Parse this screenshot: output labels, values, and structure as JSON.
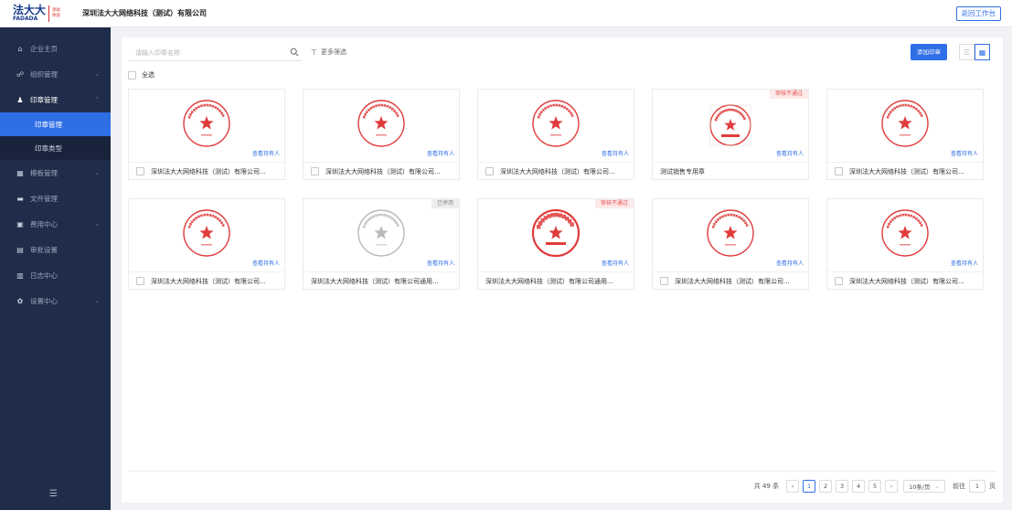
{
  "header": {
    "logo_cn": "法大大",
    "logo_en": "FADADA",
    "logo_badge_line1": "测试",
    "logo_badge_line2": "体验",
    "company": "深圳法大大网络科技（测试）有限公司",
    "back_button": "返回工作台"
  },
  "sidebar": {
    "items": [
      {
        "label": "企业主页",
        "icon": "home-icon",
        "glyph": "⌂",
        "has_chevron": false
      },
      {
        "label": "组织管理",
        "icon": "org-icon",
        "glyph": "☍",
        "has_chevron": true
      },
      {
        "label": "印章管理",
        "icon": "seal-user-icon",
        "glyph": "♟",
        "has_chevron": true,
        "open": true
      },
      {
        "label": "模板管理",
        "icon": "template-icon",
        "glyph": "▦",
        "has_chevron": true
      },
      {
        "label": "文件管理",
        "icon": "folder-icon",
        "glyph": "▬",
        "has_chevron": false
      },
      {
        "label": "费用中心",
        "icon": "fee-icon",
        "glyph": "▣",
        "has_chevron": true
      },
      {
        "label": "审批设置",
        "icon": "approval-icon",
        "glyph": "▤",
        "has_chevron": false
      },
      {
        "label": "日志中心",
        "icon": "log-icon",
        "glyph": "▥",
        "has_chevron": false
      },
      {
        "label": "设置中心",
        "icon": "settings-icon",
        "glyph": "✿",
        "has_chevron": true
      }
    ],
    "subitems": [
      {
        "label": "印章管理",
        "active": true
      },
      {
        "label": "印章类型",
        "active": false
      }
    ]
  },
  "toolbar": {
    "search_placeholder": "请输入印章名称",
    "filter_label": "更多筛选",
    "select_all": "全选",
    "add_button": "添加印章"
  },
  "cards": [
    {
      "name": "深圳法大大网络科技（测试）有限公司...",
      "view": "查看持有人",
      "tag": "",
      "seal": "red",
      "checkbox": true
    },
    {
      "name": "深圳法大大网络科技（测试）有限公司...",
      "view": "查看持有人",
      "tag": "",
      "seal": "red",
      "checkbox": true
    },
    {
      "name": "深圳法大大网络科技（测试）有限公司...",
      "view": "查看持有人",
      "tag": "",
      "seal": "red",
      "checkbox": true
    },
    {
      "name": "测试销售专用章",
      "view": "查看持有人",
      "tag": "审核不通过",
      "tag_style": "red",
      "seal": "red-small",
      "checkbox": false
    },
    {
      "name": "深圳法大大网络科技（测试）有限公司...",
      "view": "查看持有人",
      "tag": "",
      "seal": "red",
      "checkbox": true
    },
    {
      "name": "深圳法大大网络科技（测试）有限公司...",
      "view": "查看持有人",
      "tag": "",
      "seal": "red",
      "checkbox": true
    },
    {
      "name": "深圳法大大网络科技（测试）有限公司通用...",
      "view": "查看持有人",
      "tag": "已停用",
      "tag_style": "gray",
      "seal": "gray",
      "checkbox": false
    },
    {
      "name": "深圳法大大网络科技（测试）有限公司通用...",
      "view": "查看持有人",
      "tag": "审核不通过",
      "tag_style": "red",
      "seal": "red-bold",
      "checkbox": false
    },
    {
      "name": "深圳法大大网络科技（测试）有限公司...",
      "view": "查看持有人",
      "tag": "",
      "seal": "red",
      "checkbox": true
    },
    {
      "name": "深圳法大大网络科技（测试）有限公司...",
      "view": "查看持有人",
      "tag": "",
      "seal": "red",
      "checkbox": true
    }
  ],
  "pagination": {
    "total": "共 49 条",
    "pages": [
      "1",
      "2",
      "3",
      "4",
      "5"
    ],
    "current": "1",
    "page_size": "10条/页",
    "goto_prefix": "前往",
    "goto_value": "1",
    "goto_suffix": "页"
  },
  "colors": {
    "primary": "#2f6fe6",
    "sidebar_bg": "#1f2d4a",
    "seal_red": "#e03c3c",
    "seal_gray": "#b9b9b9"
  }
}
